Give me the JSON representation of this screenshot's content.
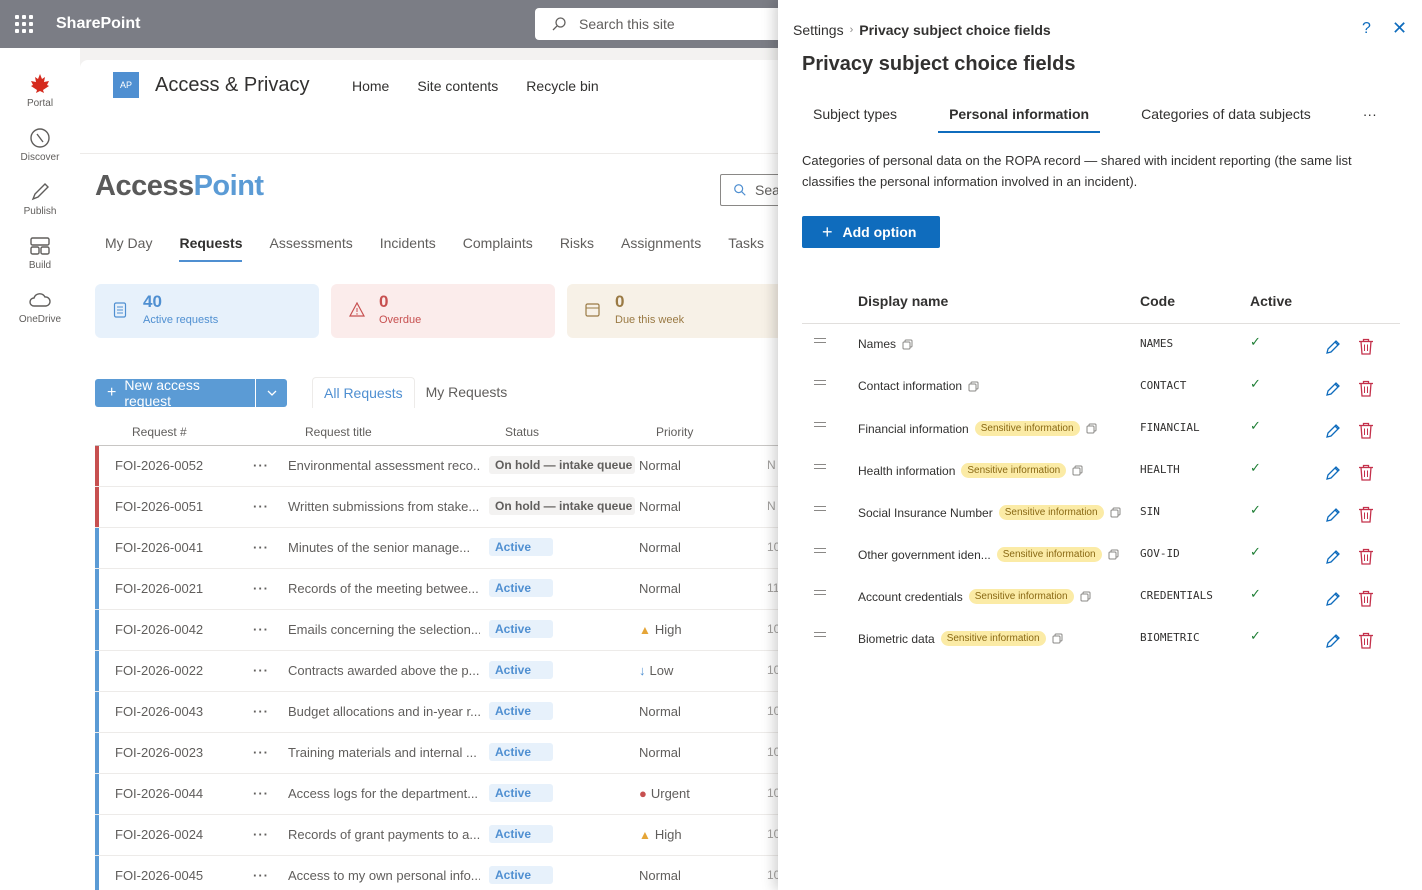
{
  "suite": {
    "title": "SharePoint",
    "search_placeholder": "Search this site"
  },
  "appbar": [
    {
      "label": "Portal",
      "icon": "maple-leaf-icon"
    },
    {
      "label": "Discover",
      "icon": "compass-icon"
    },
    {
      "label": "Publish",
      "icon": "pen-icon"
    },
    {
      "label": "Build",
      "icon": "layout-icon"
    },
    {
      "label": "OneDrive",
      "icon": "cloud-icon"
    }
  ],
  "site": {
    "logo": "AP",
    "title": "Access & Privacy",
    "nav": [
      "Home",
      "Site contents",
      "Recycle bin"
    ]
  },
  "app": {
    "logo_a": "Access",
    "logo_b": "Point",
    "search_placeholder": "Sea",
    "tabs": [
      "My Day",
      "Requests",
      "Assessments",
      "Incidents",
      "Complaints",
      "Risks",
      "Assignments",
      "Tasks"
    ],
    "active_tab": "Requests",
    "stats": [
      {
        "num": "40",
        "label": "Active requests"
      },
      {
        "num": "0",
        "label": "Overdue"
      },
      {
        "num": "0",
        "label": "Due this week"
      }
    ],
    "new_button": "New access request",
    "views": [
      "All Requests",
      "My Requests"
    ],
    "columns": [
      "Request #",
      "Request title",
      "Status",
      "Priority"
    ],
    "rows": [
      {
        "id": "FOI-2026-0052",
        "title": "Environmental assessment reco...",
        "status": "On hold — intake queue",
        "priority": "Normal",
        "trail": "N"
      },
      {
        "id": "FOI-2026-0051",
        "title": "Written submissions from stake...",
        "status": "On hold — intake queue",
        "priority": "Normal",
        "trail": "N"
      },
      {
        "id": "FOI-2026-0041",
        "title": "Minutes of the senior manage...",
        "status": "Active",
        "priority": "Normal",
        "trail": "10"
      },
      {
        "id": "FOI-2026-0021",
        "title": "Records of the meeting betwee...",
        "status": "Active",
        "priority": "Normal",
        "trail": "11"
      },
      {
        "id": "FOI-2026-0042",
        "title": "Emails concerning the selection...",
        "status": "Active",
        "priority": "High",
        "trail": "10"
      },
      {
        "id": "FOI-2026-0022",
        "title": "Contracts awarded above the p...",
        "status": "Active",
        "priority": "Low",
        "trail": "10"
      },
      {
        "id": "FOI-2026-0043",
        "title": "Budget allocations and in-year r...",
        "status": "Active",
        "priority": "Normal",
        "trail": "10"
      },
      {
        "id": "FOI-2026-0023",
        "title": "Training materials and internal ...",
        "status": "Active",
        "priority": "Normal",
        "trail": "10"
      },
      {
        "id": "FOI-2026-0044",
        "title": "Access logs for the department...",
        "status": "Active",
        "priority": "Urgent",
        "trail": "10"
      },
      {
        "id": "FOI-2026-0024",
        "title": "Records of grant payments to a...",
        "status": "Active",
        "priority": "High",
        "trail": "10"
      },
      {
        "id": "FOI-2026-0045",
        "title": "Access to my own personal info...",
        "status": "Active",
        "priority": "Normal",
        "trail": "10"
      }
    ]
  },
  "panel": {
    "crumb_root": "Settings",
    "crumb_current": "Privacy subject choice fields",
    "title": "Privacy subject choice fields",
    "tabs": [
      "Subject types",
      "Personal information",
      "Categories of data subjects",
      "···"
    ],
    "active_tab": "Personal information",
    "description": "Categories of personal data on the ROPA record — shared with incident reporting (the same list classifies the personal information involved in an incident).",
    "add_button": "Add option",
    "columns": {
      "name": "Display name",
      "code": "Code",
      "active": "Active"
    },
    "sensitive_label": "Sensitive information",
    "options": [
      {
        "name": "Names",
        "code": "NAMES",
        "sensitive": false
      },
      {
        "name": "Contact information",
        "code": "CONTACT",
        "sensitive": false
      },
      {
        "name": "Financial information",
        "code": "FINANCIAL",
        "sensitive": true
      },
      {
        "name": "Health information",
        "code": "HEALTH",
        "sensitive": true
      },
      {
        "name": "Social Insurance Number",
        "code": "SIN",
        "sensitive": true
      },
      {
        "name": "Other government iden...",
        "code": "GOV-ID",
        "sensitive": true
      },
      {
        "name": "Account credentials",
        "code": "CREDENTIALS",
        "sensitive": true
      },
      {
        "name": "Biometric data",
        "code": "BIOMETRIC",
        "sensitive": true
      }
    ]
  }
}
